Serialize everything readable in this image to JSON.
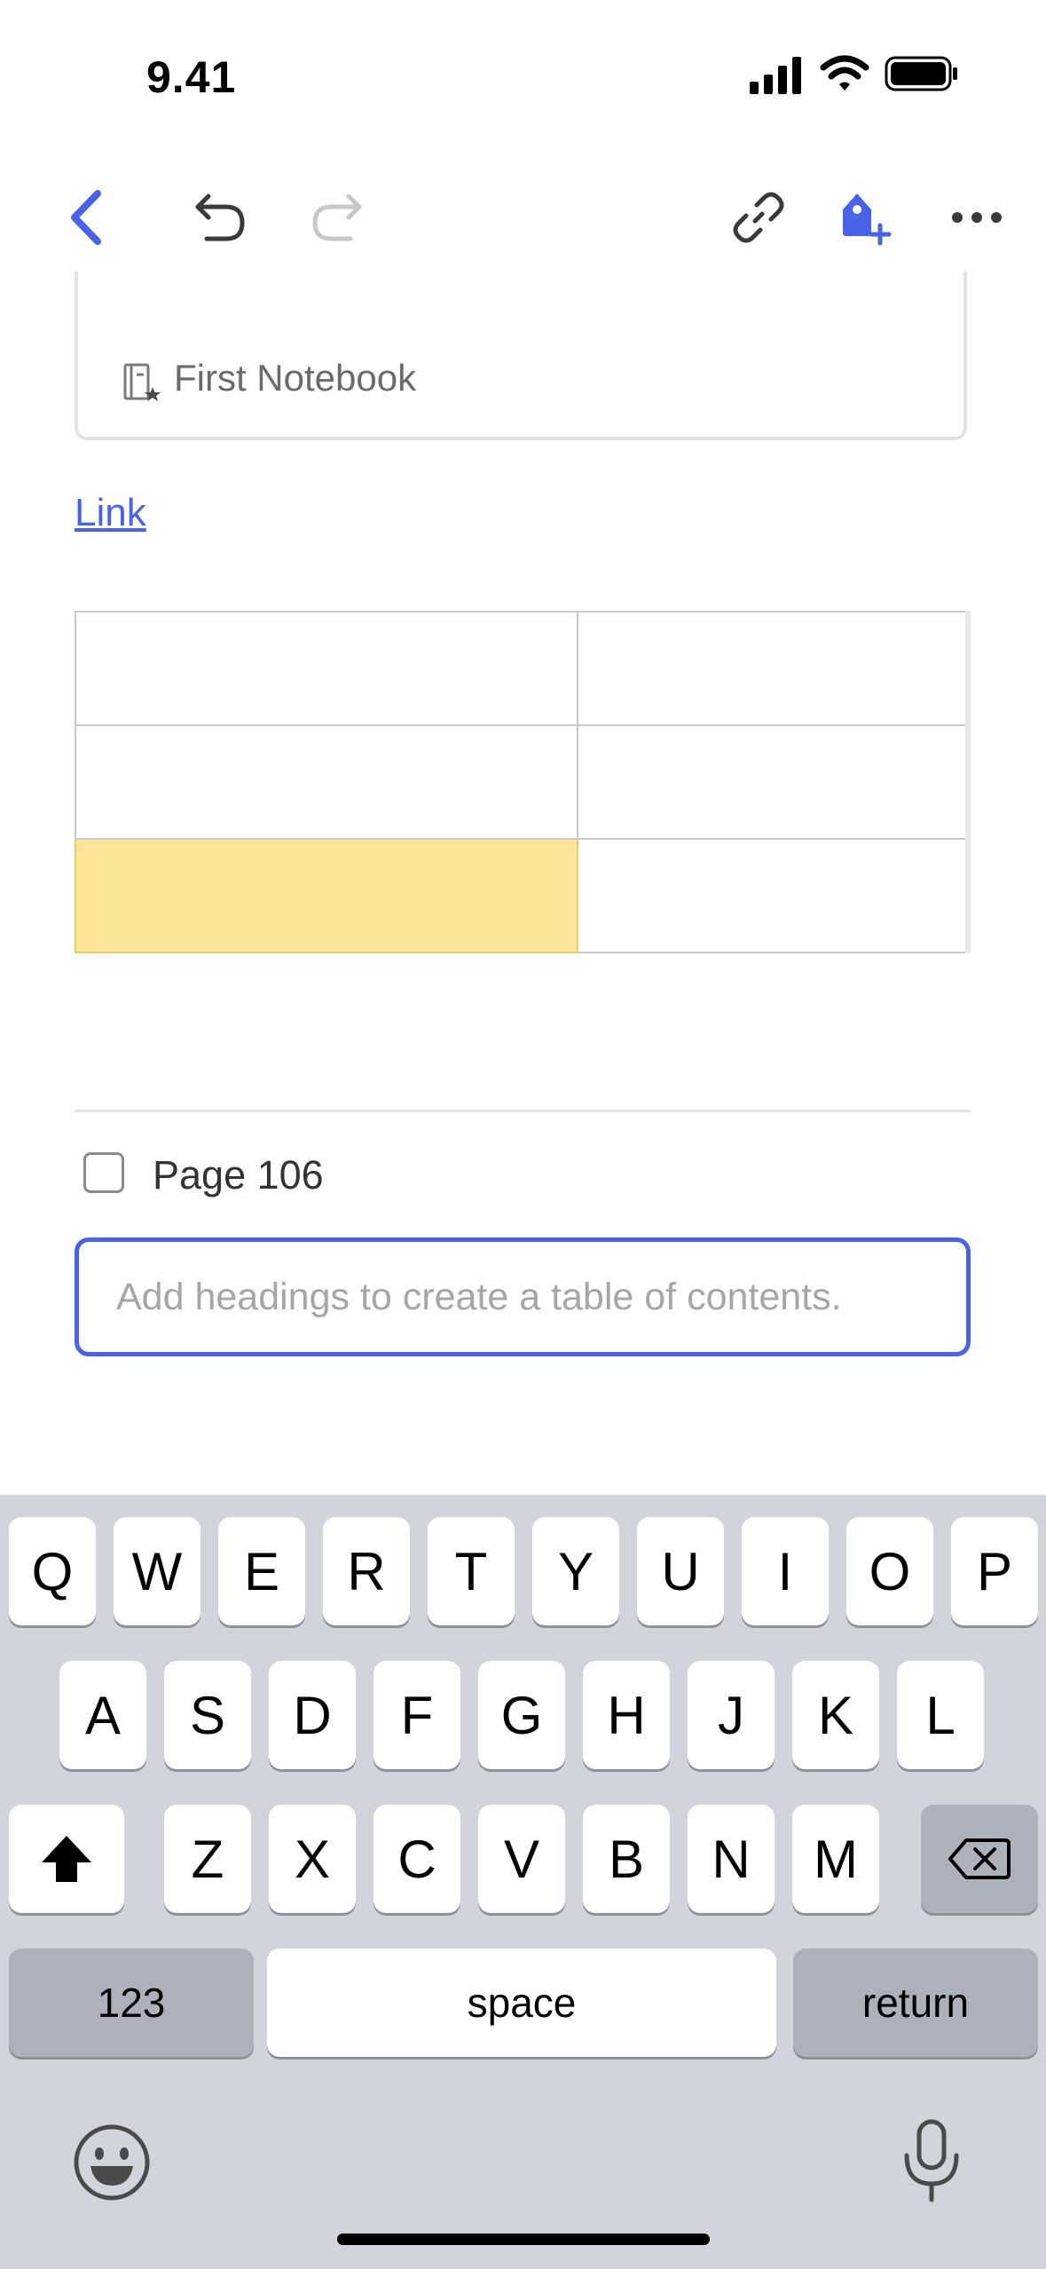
{
  "status_bar": {
    "time": "9.41"
  },
  "toolbar": {
    "back_icon": "chevron-left-icon",
    "undo_icon": "undo-icon",
    "redo_icon": "redo-icon",
    "link_icon": "link-icon",
    "tag_icon": "tag-add-icon",
    "more_icon": "more-horizontal-icon",
    "accent": "#4a63e6"
  },
  "note": {
    "notebook_label": "First Notebook",
    "link_text": "Link",
    "table": {
      "rows": 3,
      "cols": 2,
      "highlight_color": "#fde597"
    },
    "checklist": [
      {
        "label": "Page 106",
        "checked": false
      }
    ],
    "toc_placeholder": "Add headings to create a table of contents."
  },
  "keyboard": {
    "row1": [
      "Q",
      "W",
      "E",
      "R",
      "T",
      "Y",
      "U",
      "I",
      "O",
      "P"
    ],
    "row2": [
      "A",
      "S",
      "D",
      "F",
      "G",
      "H",
      "J",
      "K",
      "L"
    ],
    "row3": [
      "Z",
      "X",
      "C",
      "V",
      "B",
      "N",
      "M"
    ],
    "numbers_label": "123",
    "space_label": "space",
    "return_label": "return"
  }
}
